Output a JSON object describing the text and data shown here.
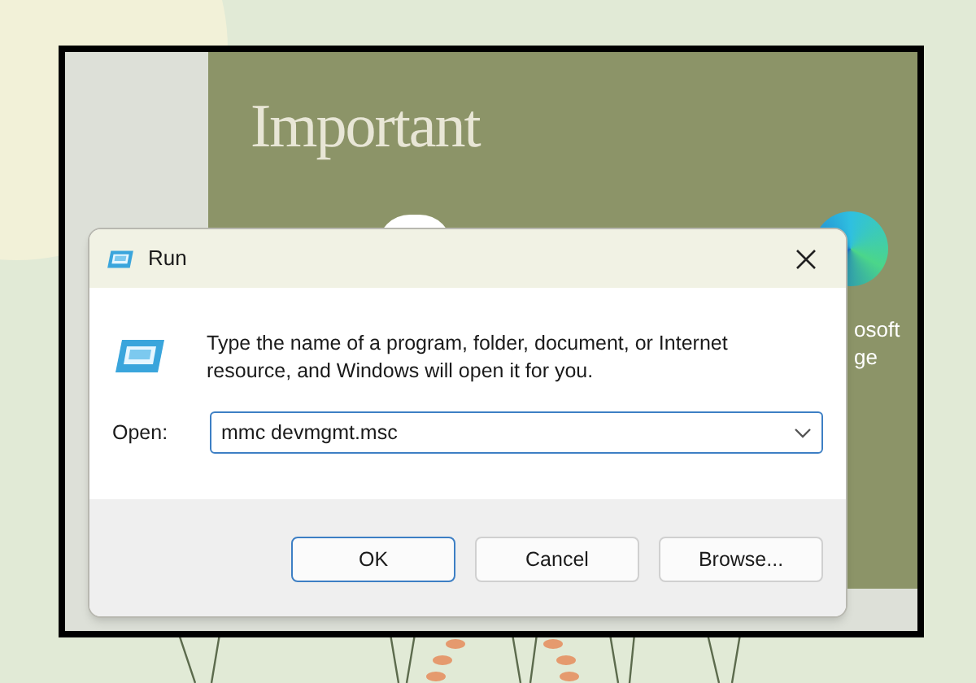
{
  "desktop": {
    "heading": "Important",
    "icon_label_lines": [
      "osoft",
      "ge"
    ]
  },
  "dialog": {
    "title": "Run",
    "message": "Type the name of a program, folder, document, or Internet resource, and Windows will open it for you.",
    "open_field": {
      "label": "Open:",
      "value": "mmc devmgmt.msc"
    },
    "buttons": [
      {
        "label": "OK",
        "default": true
      },
      {
        "label": "Cancel",
        "default": false
      },
      {
        "label": "Browse...",
        "default": false
      }
    ]
  }
}
